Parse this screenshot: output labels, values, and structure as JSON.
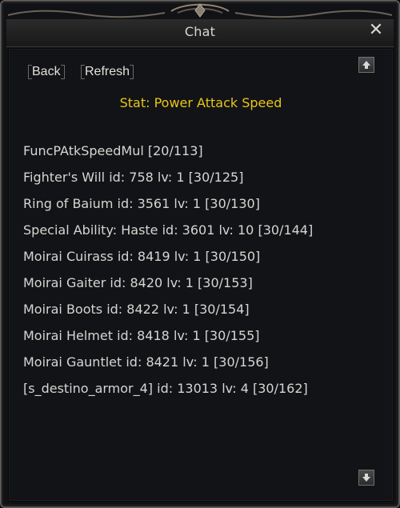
{
  "window": {
    "title": "Chat"
  },
  "toolbar": {
    "back_label": "Back",
    "refresh_label": "Refresh"
  },
  "stat": {
    "title": "Stat: Power Attack Speed"
  },
  "entries": [
    "FuncPAtkSpeedMul [20/113]",
    "Fighter's Will id: 758 lv: 1 [30/125]",
    "Ring of Baium id: 3561 lv: 1 [30/130]",
    "Special Ability: Haste id: 3601 lv: 10 [30/144]",
    "Moirai Cuirass id: 8419 lv: 1 [30/150]",
    "Moirai Gaiter id: 8420 lv: 1 [30/153]",
    "Moirai Boots id: 8422 lv: 1 [30/154]",
    "Moirai Helmet id: 8418 lv: 1 [30/155]",
    "Moirai Gauntlet id: 8421 lv: 1 [30/156]",
    "[s_destino_armor_4] id: 13013 lv: 4 [30/162]"
  ]
}
